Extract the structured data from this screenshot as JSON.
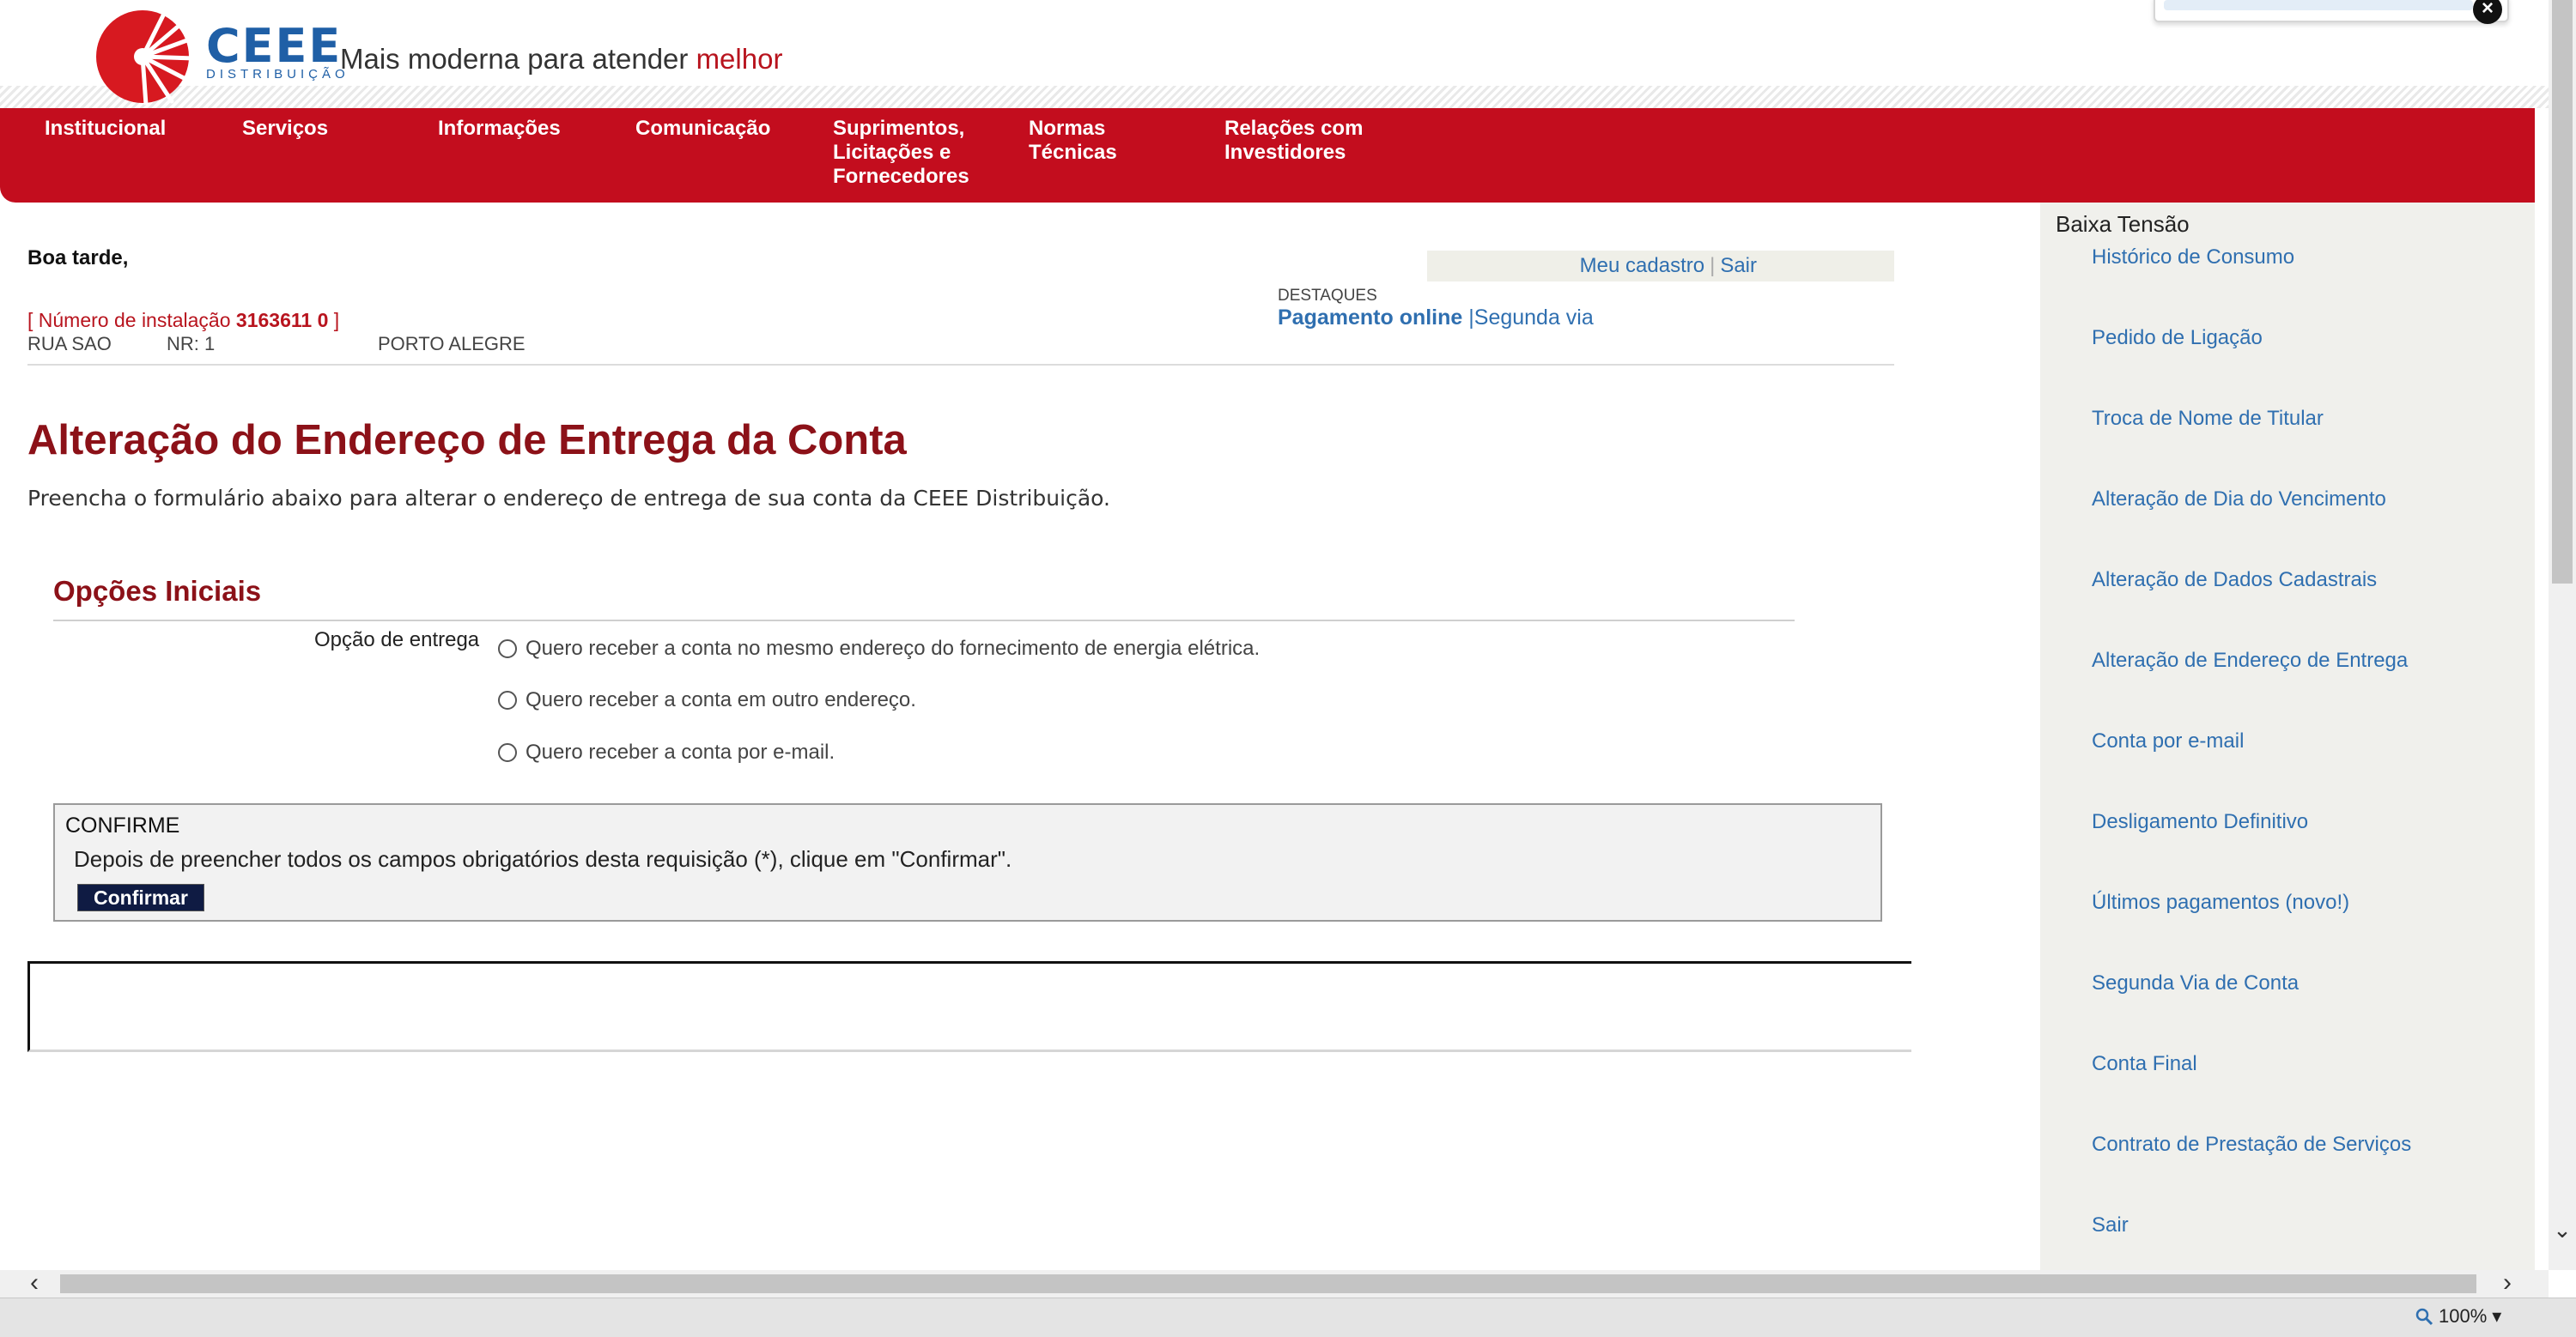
{
  "header": {
    "logo_text": "CEEE",
    "logo_subtext": "DISTRIBUIÇÃO",
    "slogan_prefix": "Mais moderna para atender ",
    "slogan_accent": "melhor"
  },
  "nav": {
    "items": [
      {
        "label": "Institucional"
      },
      {
        "label": "Serviços"
      },
      {
        "label": "Informações"
      },
      {
        "label": "Comunicação"
      },
      {
        "label": "Suprimentos,\nLicitações e\nFornecedores"
      },
      {
        "label": "Normas\nTécnicas"
      },
      {
        "label": "Relações com\nInvestidores"
      }
    ]
  },
  "user": {
    "greeting": "Boa tarde,",
    "install_prefix": "[ Número de instalação ",
    "install_number": "3163611 0",
    "install_suffix": " ]",
    "street": "RUA SAO",
    "number": "NR: 1",
    "city": "PORTO ALEGRE",
    "links": {
      "profile": "Meu cadastro",
      "separator": "|",
      "logout": "Sair"
    }
  },
  "highlights": {
    "label": "DESTAQUES",
    "payment": "Pagamento online",
    "separator": "|",
    "second_copy": "Segunda via"
  },
  "page": {
    "title": "Alteração do Endereço de Entrega da Conta",
    "subtitle": "Preencha o formulário abaixo para alterar o endereço de entrega de sua conta da CEEE Distribuição."
  },
  "form": {
    "section_title": "Opções Iniciais",
    "field_label": "Opção de entrega",
    "options": [
      {
        "label": "Quero receber a conta no mesmo endereço do fornecimento de energia elétrica."
      },
      {
        "label": "Quero receber a conta em outro endereço."
      },
      {
        "label": "Quero receber a conta por e-mail."
      }
    ]
  },
  "confirm": {
    "title": "CONFIRME",
    "text": "Depois de preencher todos os campos obrigatórios desta requisição (*), clique em \"Confirmar\".",
    "button": "Confirmar"
  },
  "sidebar": {
    "heading": "Baixa Tensão",
    "items": [
      {
        "label": "Histórico de Consumo"
      },
      {
        "label": "Pedido de Ligação"
      },
      {
        "label": "Troca de Nome de Titular"
      },
      {
        "label": "Alteração de Dia do Vencimento"
      },
      {
        "label": "Alteração de Dados Cadastrais"
      },
      {
        "label": "Alteração de Endereço de Entrega"
      },
      {
        "label": "Conta por e-mail"
      },
      {
        "label": "Desligamento Definitivo"
      },
      {
        "label": "Últimos pagamentos (novo!)"
      },
      {
        "label": "Segunda Via de Conta"
      },
      {
        "label": "Conta Final"
      },
      {
        "label": "Contrato de Prestação de Serviços"
      },
      {
        "label": "Sair"
      }
    ]
  },
  "status": {
    "zoom": "100%"
  },
  "colors": {
    "brand_red": "#c30d1e",
    "title_red": "#8c1118",
    "link_blue": "#2f6fb0",
    "button_navy": "#0f1b43"
  },
  "icons": {
    "logo": "ceee-sunburst-logo",
    "close": "close-icon",
    "zoom": "magnifier-icon"
  }
}
